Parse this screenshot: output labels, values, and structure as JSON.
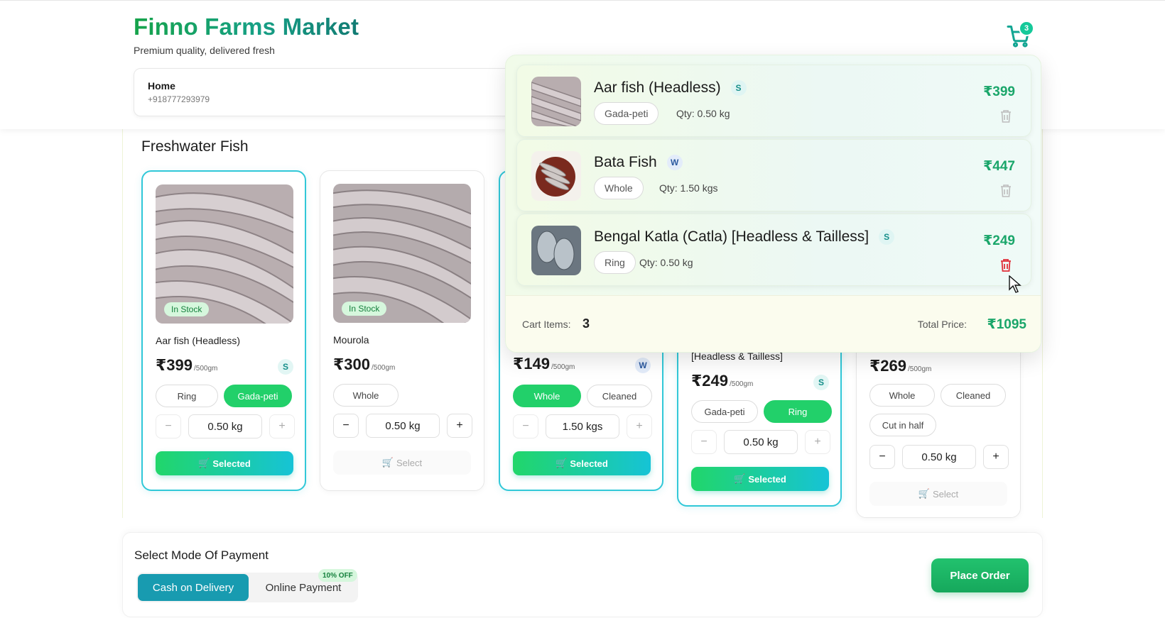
{
  "header": {
    "title": "Finno Farms Market",
    "tagline": "Premium quality, delivered fresh",
    "address_name": "Home",
    "address_phone": "+918777293979",
    "cart_count": "3",
    "cart_icon": "cart-icon"
  },
  "section": {
    "title": "Freshwater Fish"
  },
  "products": [
    {
      "name": "Aar fish (Headless)",
      "stock": "In Stock",
      "price": "₹399",
      "unit": "/500gm",
      "size": "S",
      "cuts": [
        "Ring",
        "Gada-peti"
      ],
      "selected_cut": "Gada-peti",
      "qty": "0.50 kg",
      "action": "Selected"
    },
    {
      "name": "Mourola",
      "stock": "In Stock",
      "price": "₹300",
      "unit": "/500gm",
      "size": "",
      "cuts": [
        "Whole"
      ],
      "qty": "0.50 kg",
      "action": "Select"
    },
    {
      "price": "₹149",
      "unit": "/500gm",
      "size": "W",
      "cuts": [
        "Whole",
        "Cleaned"
      ],
      "selected_cut": "Whole",
      "qty": "1.50 kgs",
      "action": "Selected"
    },
    {
      "name": "[Headless & Tailless]",
      "price": "₹249",
      "unit": "/500gm",
      "size": "S",
      "cuts": [
        "Gada-peti",
        "Ring"
      ],
      "selected_cut": "Ring",
      "qty": "0.50 kg",
      "action": "Selected"
    },
    {
      "price": "₹269",
      "unit": "/500gm",
      "cuts": [
        "Whole",
        "Cleaned",
        "Cut in half"
      ],
      "qty": "0.50 kg",
      "action": "Select"
    }
  ],
  "cart": {
    "items": [
      {
        "name": "Aar fish (Headless)",
        "size": "S",
        "cut": "Gada-peti",
        "qty": "Qty: 0.50 kg",
        "price": "₹399"
      },
      {
        "name": "Bata Fish",
        "size": "W",
        "cut": "Whole",
        "qty": "Qty: 1.50 kgs",
        "price": "₹447"
      },
      {
        "name": "Bengal Katla (Catla) [Headless & Tailless]",
        "size": "S",
        "cut": "Ring",
        "qty": "Qty: 0.50 kg",
        "price": "₹249"
      }
    ],
    "items_label": "Cart Items:",
    "items_count": "3",
    "total_label": "Total Price:",
    "total": "₹1095"
  },
  "payment": {
    "title": "Select Mode Of Payment",
    "options": [
      "Cash on Delivery",
      "Online Payment"
    ],
    "selected": "Cash on Delivery",
    "online_discount": "10% OFF",
    "place_order": "Place Order"
  },
  "colors": {
    "brand_green": "#16a34a",
    "accent_teal": "#189bb0",
    "price_green": "#1aa66a"
  }
}
